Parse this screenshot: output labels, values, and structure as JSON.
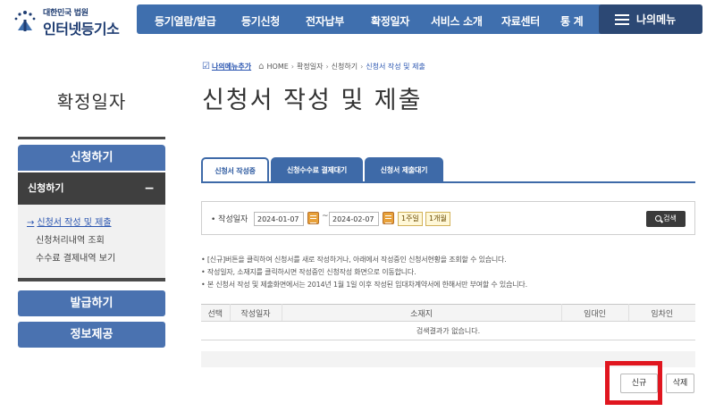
{
  "header": {
    "logo_small": "대한민국 법원",
    "logo_big": "인터넷등기소",
    "nav": [
      "등기열람/발급",
      "등기신청",
      "전자납부",
      "확정일자",
      "서비스 소개",
      "자료센터",
      "통 계"
    ],
    "mymenu": "나의메뉴"
  },
  "breadcrumb": {
    "favorite": "나의메뉴추가",
    "items": [
      "HOME",
      "확정일자",
      "신청하기"
    ],
    "current": "신청서 작성 및 제출"
  },
  "page_title": "신청서 작성 및 제출",
  "sidebar": {
    "title": "확정일자",
    "menu1": "신청하기",
    "sub_header": "신청하기",
    "sub_items": [
      "신청서 작성 및 제출",
      "신청처리내역 조회",
      "수수료 결제내역 보기"
    ],
    "menu2": "발급하기",
    "menu3": "정보제공"
  },
  "tabs": [
    "신청서 작성중",
    "신청수수료 결제대기",
    "신청서 제출대기"
  ],
  "search": {
    "label": "작성일자",
    "date_from": "2024-01-07",
    "tilde": "~",
    "date_to": "2024-02-07",
    "period_week": "1주일",
    "period_month": "1개월",
    "button": "검색"
  },
  "notes": [
    "[신규]버튼을 클릭하여 신청서를 새로 작성하거나, 아래에서 작성중인 신청서현황을 조회할 수 있습니다.",
    "작성일자, 소재지를 클릭하시면 작성중인 신청작성 화면으로 이동합니다.",
    "본 신청서 작성 및 제출화면에서는 2014년 1월 1일 이후 작성된 임대차계약서에 한해서만 부여할 수 있습니다."
  ],
  "table": {
    "columns": [
      "선택",
      "작성일자",
      "소재지",
      "임대인",
      "임차인"
    ],
    "empty_message": "검색결과가 없습니다."
  },
  "buttons": {
    "new": "신규",
    "delete": "삭제"
  },
  "colors": {
    "primary_blue": "#3f6fae",
    "dark_navy": "#2c4874",
    "highlight_red": "#e0161f"
  }
}
